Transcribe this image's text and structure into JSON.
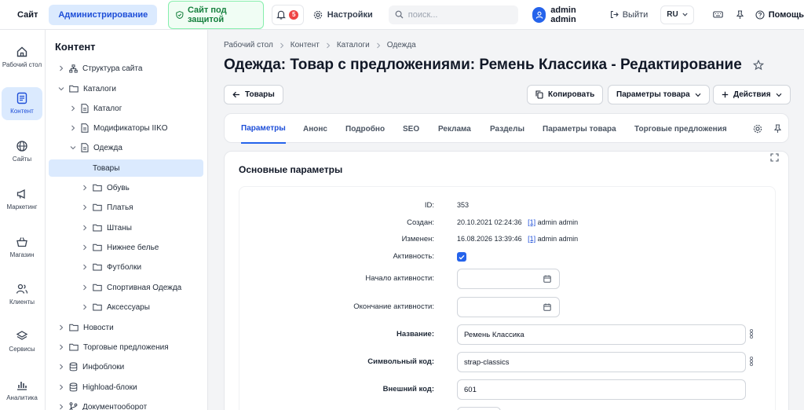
{
  "topbar": {
    "site": "Сайт",
    "admin": "Администрирование",
    "protected": "Сайт под защитой",
    "notifications_count": "5",
    "settings": "Настройки",
    "search_placeholder": "поиск...",
    "user": "admin admin",
    "exit": "Выйти",
    "lang": "RU",
    "help": "Помощь"
  },
  "rail": [
    {
      "label": "Рабочий стол",
      "icon": "home-icon"
    },
    {
      "label": "Контент",
      "icon": "document-icon"
    },
    {
      "label": "Сайты",
      "icon": "globe-icon"
    },
    {
      "label": "Маркетинг",
      "icon": "megaphone-icon"
    },
    {
      "label": "Магазин",
      "icon": "basket-icon"
    },
    {
      "label": "Клиенты",
      "icon": "users-icon"
    },
    {
      "label": "Сервисы",
      "icon": "layers-icon"
    },
    {
      "label": "Аналитика",
      "icon": "chart-icon"
    }
  ],
  "tree": {
    "title": "Контент",
    "items": [
      {
        "label": "Структура сайта",
        "icon": "sitemap-icon"
      },
      {
        "label": "Каталоги",
        "icon": "folder-icon"
      },
      {
        "label": "Каталог",
        "icon": "file-icon"
      },
      {
        "label": "Модификаторы IIKO",
        "icon": "file-icon"
      },
      {
        "label": "Одежда",
        "icon": "file-icon"
      },
      {
        "label": "Товары",
        "icon": ""
      },
      {
        "label": "Обувь",
        "icon": "folder-icon"
      },
      {
        "label": "Платья",
        "icon": "folder-icon"
      },
      {
        "label": "Штаны",
        "icon": "folder-icon"
      },
      {
        "label": "Нижнее белье",
        "icon": "folder-icon"
      },
      {
        "label": "Футболки",
        "icon": "folder-icon"
      },
      {
        "label": "Спортивная Одежда",
        "icon": "folder-icon"
      },
      {
        "label": "Аксессуары",
        "icon": "folder-icon"
      },
      {
        "label": "Новости",
        "icon": "folder-icon"
      },
      {
        "label": "Торговые предложения",
        "icon": "folder-icon"
      },
      {
        "label": "Инфоблоки",
        "icon": "database-icon"
      },
      {
        "label": "Highload-блоки",
        "icon": "database-icon"
      },
      {
        "label": "Документооборот",
        "icon": "branch-icon"
      }
    ]
  },
  "breadcrumb": [
    "Рабочий стол",
    "Контент",
    "Каталоги",
    "Одежда"
  ],
  "title": "Одежда: Товар с предложениями: Ремень Классика - Редактирование",
  "actions": {
    "back": "Товары",
    "copy": "Копировать",
    "params": "Параметры товара",
    "more": "Действия"
  },
  "tabs": [
    "Параметры",
    "Анонс",
    "Подробно",
    "SEO",
    "Реклама",
    "Разделы",
    "Параметры товара",
    "Торговые предложения"
  ],
  "section": {
    "title": "Основные параметры",
    "id_label": "ID:",
    "id_value": "353",
    "created_label": "Создан:",
    "created_value": "20.10.2021 02:24:36",
    "created_user_id": "[1]",
    "created_user": "admin admin",
    "modified_label": "Изменен:",
    "modified_value": "16.08.2026 13:39:46",
    "modified_user_id": "[1]",
    "modified_user": "admin admin",
    "active_label": "Активность:",
    "active_from_label": "Начало активности:",
    "active_to_label": "Окончание активности:",
    "name_label": "Название:",
    "name_value": "Ремень Классика",
    "code_label": "Символьный код:",
    "code_value": "strap-classics",
    "xml_label": "Внешний код:",
    "xml_value": "601"
  },
  "colors": {
    "accent": "#2563eb",
    "accent_bg": "#dbeafe",
    "protect": "#15803d",
    "badge": "#ef4444"
  }
}
